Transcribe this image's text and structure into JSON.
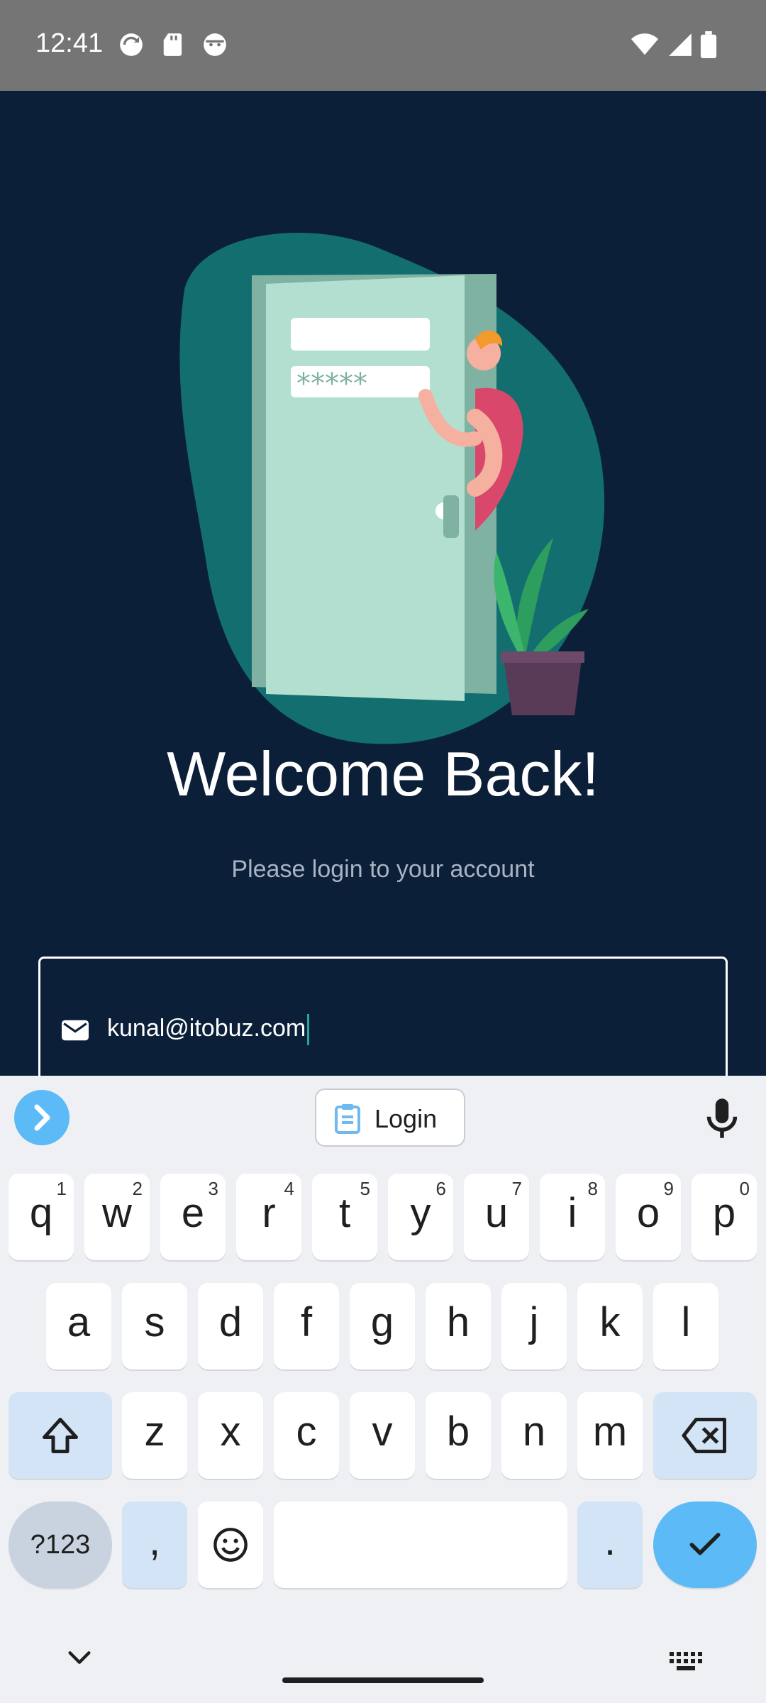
{
  "status_bar": {
    "time": "12:41",
    "icons": [
      "sync-icon",
      "sd-card-icon",
      "android-face-icon",
      "wifi-icon",
      "signal-icon",
      "battery-icon"
    ]
  },
  "app": {
    "title": "Welcome Back!",
    "subtitle": "Please login to your account",
    "email_value": "kunal@itobuz.com",
    "illustration_password": "*****"
  },
  "keyboard": {
    "suggestion": "Login",
    "row1": [
      {
        "ch": "q",
        "num": "1"
      },
      {
        "ch": "w",
        "num": "2"
      },
      {
        "ch": "e",
        "num": "3"
      },
      {
        "ch": "r",
        "num": "4"
      },
      {
        "ch": "t",
        "num": "5"
      },
      {
        "ch": "y",
        "num": "6"
      },
      {
        "ch": "u",
        "num": "7"
      },
      {
        "ch": "i",
        "num": "8"
      },
      {
        "ch": "o",
        "num": "9"
      },
      {
        "ch": "p",
        "num": "0"
      }
    ],
    "row2": [
      "a",
      "s",
      "d",
      "f",
      "g",
      "h",
      "j",
      "k",
      "l"
    ],
    "row3": [
      "z",
      "x",
      "c",
      "v",
      "b",
      "n",
      "m"
    ],
    "symbols_label": "?123",
    "comma": ",",
    "period": "."
  },
  "colors": {
    "background": "#0c1f38",
    "accent": "#5cbaf7",
    "blob": "#136e70",
    "door": "#b2dfd0"
  }
}
